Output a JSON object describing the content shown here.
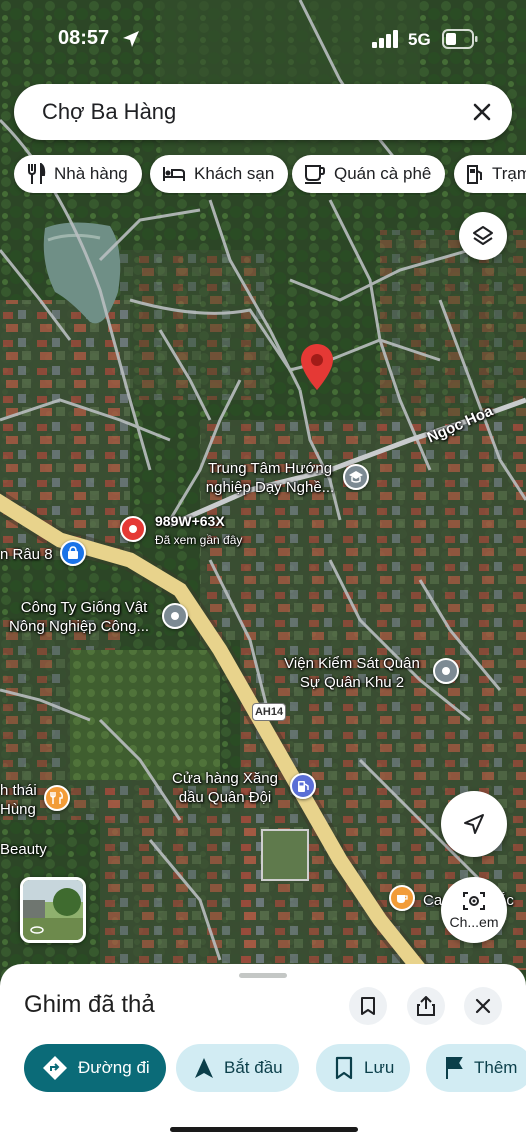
{
  "status_bar": {
    "time": "08:57",
    "network": "5G"
  },
  "search": {
    "query": "Chợ Ba Hàng"
  },
  "chips": [
    {
      "label": "Nhà hàng",
      "icon": "fork-knife-icon"
    },
    {
      "label": "Khách sạn",
      "icon": "bed-icon"
    },
    {
      "label": "Quán cà phê",
      "icon": "coffee-cup-icon"
    },
    {
      "label": "Trạm",
      "icon": "fuel-pump-icon"
    }
  ],
  "map": {
    "road_name": "Ngọc Hoa",
    "highway_shield": "AH14",
    "places": {
      "training_center": {
        "line1": "Trung Tâm Hướng",
        "line2": "nghiệp Dạy Nghề..."
      },
      "plus_code": {
        "line1": "989W+63X",
        "line2": "Đã xem gần đây"
      },
      "rau8": {
        "line1": "n Râu 8"
      },
      "seed_company": {
        "line1": "Công Ty Giống Vật",
        "line2": "Nông Nghiệp Công..."
      },
      "procuracy": {
        "line1": "Viện Kiểm Sát Quân",
        "line2": "Sự Quân Khu 2"
      },
      "restaurant_left": {
        "line1": "h thái",
        "line2": "Hùng"
      },
      "gas_station": {
        "line1": "Cửa hàng Xăng",
        "line2": "dầu Quân Đội"
      },
      "beauty": {
        "line1": "Beauty"
      },
      "cafe": {
        "line1": "Ca",
        "line2": "ắc"
      }
    },
    "colors": {
      "pin": "#e53935",
      "highway": "#e8d38c",
      "water": "#6f8f86"
    }
  },
  "controls": {
    "search_by_image_label": "Ch...em"
  },
  "sheet": {
    "title": "Ghim đã thả",
    "actions": [
      {
        "label": "Đường đi",
        "icon": "directions-icon"
      },
      {
        "label": "Bắt đầu",
        "icon": "navigation-arrow-icon"
      },
      {
        "label": "Lưu",
        "icon": "bookmark-icon"
      },
      {
        "label": "Thêm",
        "icon": "flag-icon"
      }
    ]
  }
}
